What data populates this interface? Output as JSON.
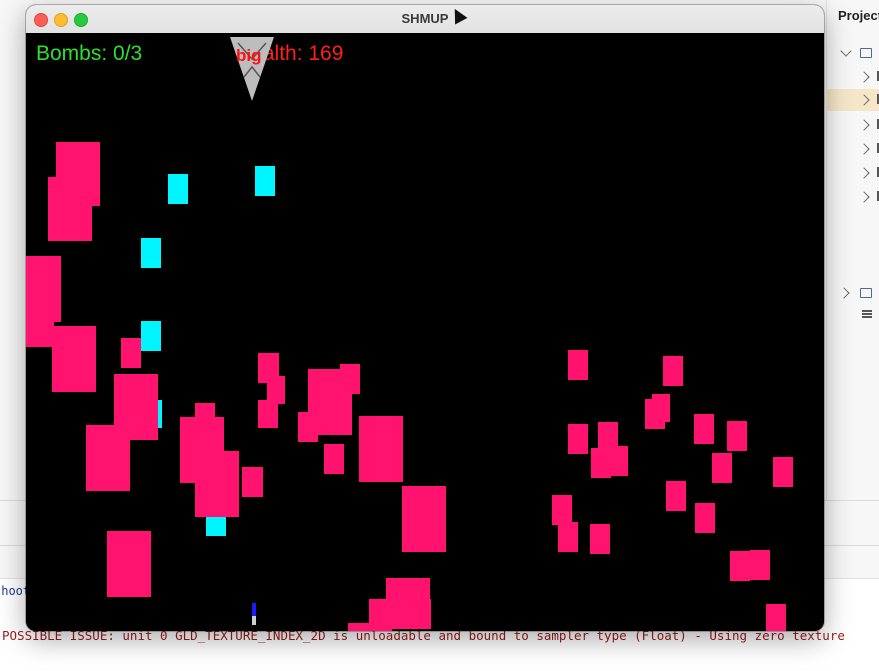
{
  "ide": {
    "panel_title": "Project",
    "console_run_line": "shoot",
    "console_warning": "POSSIBLE ISSUE: unit 0 GLD_TEXTURE_INDEX_2D is unloadable and bound to sampler type (Float) - Using zero texture"
  },
  "window": {
    "title": "SHMUP",
    "close_icon": "close-icon",
    "minimize_icon": "minimize-icon",
    "maximize_icon": "maximize-icon"
  },
  "game": {
    "bombs_text": "Bombs: 0/3",
    "health_text": "Health: 169",
    "hit_marker_text": "big",
    "colors": {
      "background": "#000000",
      "enemy": "#ff136f",
      "bullet": "#00f6ff",
      "bombs": "#2ee02e",
      "health": "#ff1f1f",
      "ship": "#bdbdbd",
      "player": "#1b1bff"
    },
    "enemy_count": 45,
    "bullet_count": 7
  }
}
